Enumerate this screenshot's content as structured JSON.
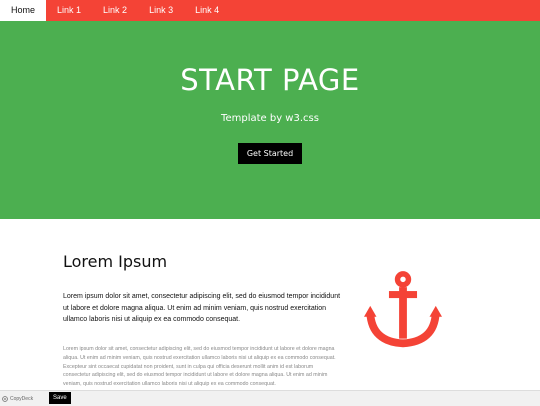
{
  "nav": {
    "items": [
      {
        "label": "Home"
      },
      {
        "label": "Link 1"
      },
      {
        "label": "Link 2"
      },
      {
        "label": "Link 3"
      },
      {
        "label": "Link 4"
      }
    ]
  },
  "hero": {
    "title": "START PAGE",
    "subtitle": "Template by w3.css",
    "button": "Get Started"
  },
  "content": {
    "heading": "Lorem Ipsum",
    "lead": "Lorem ipsum dolor sit amet, consectetur adipiscing elit, sed do eiusmod tempor incididunt ut labore et dolore magna aliqua. Ut enim ad minim veniam, quis nostrud exercitation ullamco laboris nisi ut aliquip ex ea commodo consequat.",
    "body": "Lorem ipsum dolor sit amet, consectetur adipiscing elit, sed do eiusmod tempor incididunt ut labore et dolore magna aliqua. Ut enim ad minim veniam, quis nostrud exercitation ullamco laboris nisi ut aliquip ex ea commodo consequat. Excepteur sint occaecat cupidatat non proident, sunt in culpa qui officia deserunt mollit anim id est laborum consectetur adipiscing elit, sed do eiusmod tempor incididunt ut labore et dolore magna aliqua. Ut enim ad minim veniam, quis nostrud exercitation ullamco laboris nisi ut aliquip ex ea commodo consequat.",
    "icon": "anchor-icon"
  },
  "bottombar": {
    "brand": "CopyDeck",
    "save": "Save"
  },
  "colors": {
    "nav": "#f44336",
    "hero": "#4caf50",
    "anchor": "#f44336"
  }
}
